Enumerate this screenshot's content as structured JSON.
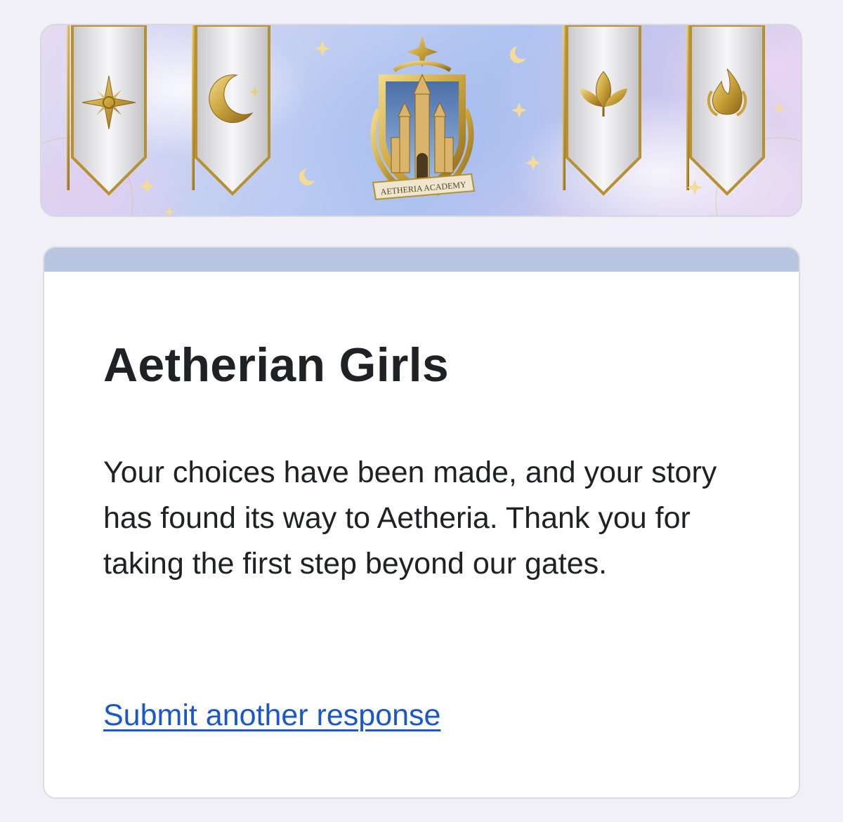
{
  "banner": {
    "crest_text": "AETHERIA ACADEMY",
    "emblems": [
      "compass-star-icon",
      "crescent-moon-icon",
      "leaf-icon",
      "flame-icon"
    ],
    "colors": {
      "sky": "#aec3f0",
      "gold": "#c9a23a",
      "banner_fabric": "#ecebec"
    }
  },
  "form": {
    "title": "Aetherian Girls",
    "confirmation_message": "Your choices have been made, and your story has found its way to Aetheria. Thank you for taking the first step beyond our gates.",
    "submit_another_label": "Submit another response"
  },
  "theme": {
    "accent": "#bac5e1",
    "link": "#1a57c9",
    "page_bg": "#f0f0f6"
  }
}
